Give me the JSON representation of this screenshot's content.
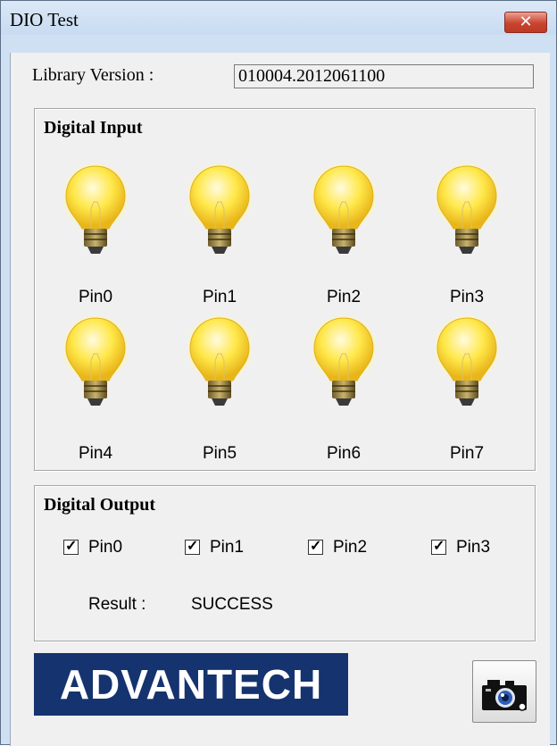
{
  "window": {
    "title": "DIO Test",
    "close_glyph": "✕"
  },
  "library": {
    "label": "Library Version :",
    "value": "010004.2012061100"
  },
  "digital_input": {
    "title": "Digital Input",
    "pins": [
      {
        "label": "Pin0",
        "state": "on",
        "icon": "lightbulb-on-icon"
      },
      {
        "label": "Pin1",
        "state": "on",
        "icon": "lightbulb-on-icon"
      },
      {
        "label": "Pin2",
        "state": "on",
        "icon": "lightbulb-on-icon"
      },
      {
        "label": "Pin3",
        "state": "on",
        "icon": "lightbulb-on-icon"
      },
      {
        "label": "Pin4",
        "state": "on",
        "icon": "lightbulb-on-icon"
      },
      {
        "label": "Pin5",
        "state": "on",
        "icon": "lightbulb-on-icon"
      },
      {
        "label": "Pin6",
        "state": "on",
        "icon": "lightbulb-on-icon"
      },
      {
        "label": "Pin7",
        "state": "on",
        "icon": "lightbulb-on-icon"
      }
    ]
  },
  "digital_output": {
    "title": "Digital Output",
    "pins": [
      {
        "label": "Pin0",
        "checked": true
      },
      {
        "label": "Pin1",
        "checked": true
      },
      {
        "label": "Pin2",
        "checked": true
      },
      {
        "label": "Pin3",
        "checked": true
      }
    ],
    "result_label": "Result :",
    "result_value": "SUCCESS"
  },
  "branding": {
    "logo_text": "ADVANTECH",
    "logo_bg": "#15336e"
  },
  "toolbar": {
    "camera_icon": "camera-icon"
  },
  "colors": {
    "titlebar": "#cfe0f3",
    "close_button": "#c9442f",
    "client_bg": "#f0f0f0",
    "bulb_glow": "#ffe84a"
  }
}
